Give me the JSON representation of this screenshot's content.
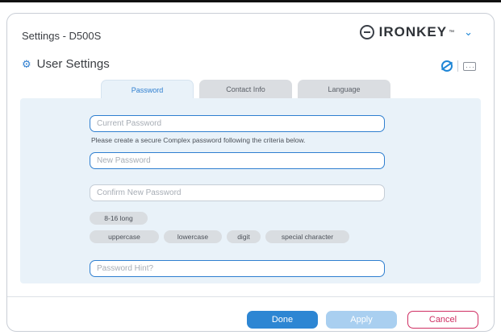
{
  "window": {
    "title": "Settings - D500S"
  },
  "brand": {
    "name": "IRONKEY",
    "tm": "™",
    "chevron": "⌄"
  },
  "header": {
    "title": "User Settings",
    "gear": "⚙"
  },
  "tabs": [
    {
      "label": "Password",
      "active": true
    },
    {
      "label": "Contact Info",
      "active": false
    },
    {
      "label": "Language",
      "active": false
    }
  ],
  "form": {
    "current_password": {
      "placeholder": "Current Password"
    },
    "helper_text": "Please create a secure Complex password following the criteria below.",
    "new_password": {
      "placeholder": "New Password"
    },
    "confirm_password": {
      "placeholder": "Confirm New Password"
    },
    "criteria": {
      "length": "8-16 long",
      "items": [
        "uppercase",
        "lowercase",
        "digit",
        "special character"
      ]
    },
    "hint": {
      "placeholder": "Password Hint?"
    }
  },
  "buttons": {
    "done": "Done",
    "apply": "Apply",
    "cancel": "Cancel"
  },
  "colors": {
    "accent": "#2d86d3",
    "panel": "#e9f2f9",
    "cancel": "#cf2e62"
  },
  "icons": [
    "ironkey-logo-icon",
    "chevron-down-icon",
    "gear-icon",
    "eye-hidden-icon",
    "keyboard-icon"
  ]
}
